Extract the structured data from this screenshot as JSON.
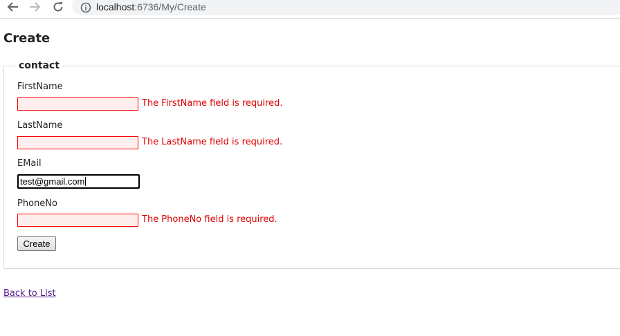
{
  "browser": {
    "url_host": "localhost",
    "url_path": ":6736/My/Create"
  },
  "page": {
    "title": "Create"
  },
  "form": {
    "legend": "contact",
    "first_name": {
      "label": "FirstName",
      "value": "",
      "error": "The FirstName field is required."
    },
    "last_name": {
      "label": "LastName",
      "value": "",
      "error": "The LastName field is required."
    },
    "email": {
      "label": "EMail",
      "value": "test@gmail.com"
    },
    "phone_no": {
      "label": "PhoneNo",
      "value": "",
      "error": "The PhoneNo field is required."
    },
    "submit_label": "Create"
  },
  "back_link": "Back to List",
  "colors": {
    "error_text": "#e00000",
    "error_border": "#ff0000",
    "error_background": "#ffeeee",
    "visited_link": "#551a8b"
  }
}
